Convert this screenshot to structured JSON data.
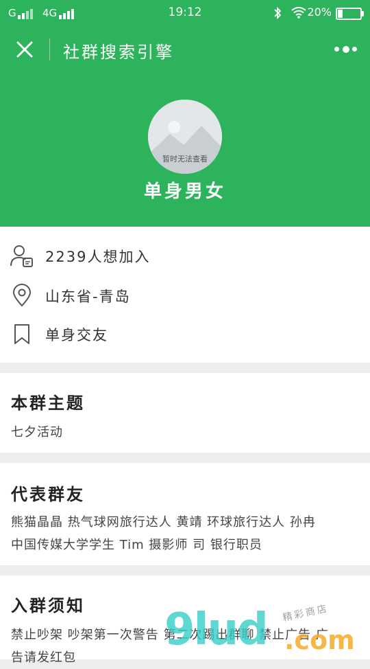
{
  "status_bar": {
    "network_1": "G",
    "network_2": "4G",
    "time": "19:12",
    "battery_percent": "20%",
    "battery_level": 0.2
  },
  "nav": {
    "title": "社群搜索引擎",
    "close_icon": "close-icon",
    "more_icon": "more-icon"
  },
  "group": {
    "avatar_caption": "暂时无法查看",
    "name": "单身男女"
  },
  "info": {
    "members": "2239人想加入",
    "location": "山东省-青岛",
    "tag": "单身交友",
    "icons": [
      "person-card-icon",
      "location-pin-icon",
      "bookmark-icon"
    ]
  },
  "sections": {
    "theme": {
      "title": "本群主题",
      "content": "七夕活动"
    },
    "members": {
      "title": "代表群友",
      "line1": "熊猫晶晶 热气球网旅行达人 黄靖 环球旅行达人 孙冉",
      "line2": "中国传媒大学学生 Tim 摄影师 司 银行职员"
    },
    "rules": {
      "title": "入群须知",
      "line1": "禁止吵架 吵架第一次警告 第二次踢出群聊 禁止广告 广",
      "line2": "告请发红包"
    }
  },
  "watermark": {
    "big": "9lud",
    "com": ".com",
    "small": "精彩商店"
  },
  "colors": {
    "brand_green": "#2db35c",
    "background": "#ededed"
  }
}
